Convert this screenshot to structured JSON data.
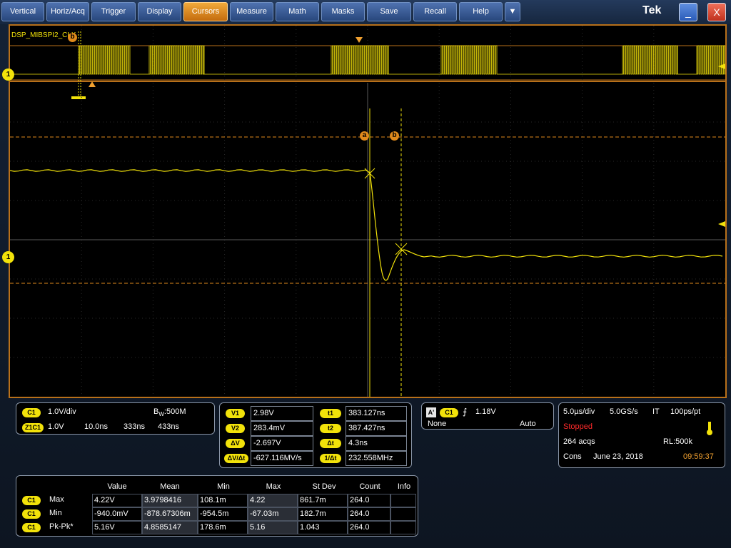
{
  "menu": {
    "items": [
      "Vertical",
      "Horiz/Acq",
      "Trigger",
      "Display",
      "Cursors",
      "Measure",
      "Math",
      "Masks",
      "Save",
      "Recall",
      "Help"
    ],
    "active": "Cursors",
    "dropdown_glyph": "▼",
    "brand": "Tek",
    "minimize_glyph": "_",
    "close_glyph": "X"
  },
  "display": {
    "bus_label": "DSP_MIBSPI2_CLK",
    "channel_tag": "1",
    "cursor_a": "a",
    "cursor_b": "b",
    "trace_color": "#f2e20a",
    "cursor_color": "#e08a1c"
  },
  "channel_panel": {
    "c1_tag": "C1",
    "scale": "1.0V/div",
    "bw_label": "B",
    "bw_sup": "W",
    "bw_value": ":500M",
    "zoom_tag": "Z1C1",
    "zoom_scale": "1.0V",
    "zoom_time": "10.0ns",
    "zoom_pos1": "333ns",
    "zoom_pos2": "433ns"
  },
  "cursor_panel": {
    "v1_label": "V1",
    "v1": "2.98V",
    "v2_label": "V2",
    "v2": "283.4mV",
    "dv_label": "ΔV",
    "dv": "-2.697V",
    "dvdt_label": "ΔV/Δt",
    "dvdt": "-627.116MV/s",
    "t1_label": "t1",
    "t1": "383.127ns",
    "t2_label": "t2",
    "t2": "387.427ns",
    "dt_label": "Δt",
    "dt": "4.3ns",
    "inv_dt_label": "1/Δt",
    "inv_dt": "232.558MHz"
  },
  "trigger_panel": {
    "a_tag": "A'",
    "src": "C1",
    "slope_glyph": "⨍",
    "level": "1.18V",
    "coupling": "None",
    "mode": "Auto"
  },
  "acq_panel": {
    "timebase": "5.0µs/div",
    "sample_rate": "5.0GS/s",
    "mode": "IT",
    "resolution": "100ps/pt",
    "state": "Stopped",
    "acqs": "264 acqs",
    "record_length": "RL:500k",
    "cons": "Cons",
    "date": "June 23, 2018",
    "time": "09:59:37"
  },
  "measurements": {
    "headers": [
      "Value",
      "Mean",
      "Min",
      "Max",
      "St Dev",
      "Count",
      "Info"
    ],
    "rows": [
      {
        "src": "C1",
        "name": "Max",
        "cells": [
          "4.22V",
          "3.9798416",
          "108.1m",
          "4.22",
          "861.7m",
          "264.0",
          ""
        ]
      },
      {
        "src": "C1",
        "name": "Min",
        "cells": [
          "-940.0mV",
          "-878.67306m",
          "-954.5m",
          "-67.03m",
          "182.7m",
          "264.0",
          ""
        ]
      },
      {
        "src": "C1",
        "name": "Pk-Pk*",
        "cells": [
          "5.16V",
          "4.8585147",
          "178.6m",
          "5.16",
          "1.043",
          "264.0",
          ""
        ]
      }
    ]
  }
}
